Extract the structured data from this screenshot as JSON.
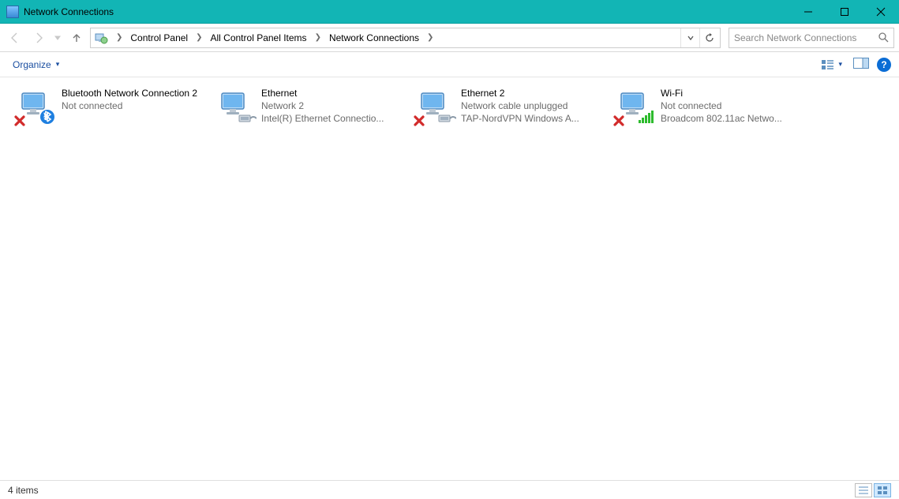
{
  "window": {
    "title": "Network Connections"
  },
  "breadcrumb": {
    "items": [
      "Control Panel",
      "All Control Panel Items",
      "Network Connections"
    ]
  },
  "search": {
    "placeholder": "Search Network Connections"
  },
  "cmdbar": {
    "organize": "Organize"
  },
  "connections": [
    {
      "name": "Bluetooth Network Connection 2",
      "status": "Not connected",
      "device": "",
      "icon": "bluetooth",
      "broken": true
    },
    {
      "name": "Ethernet",
      "status": "Network 2",
      "device": "Intel(R) Ethernet Connectio...",
      "icon": "ethernet",
      "broken": false
    },
    {
      "name": "Ethernet 2",
      "status": "Network cable unplugged",
      "device": "TAP-NordVPN Windows A...",
      "icon": "ethernet",
      "broken": true
    },
    {
      "name": "Wi-Fi",
      "status": "Not connected",
      "device": "Broadcom 802.11ac Netwo...",
      "icon": "wifi",
      "broken": true
    }
  ],
  "statusbar": {
    "item_count": "4 items"
  }
}
